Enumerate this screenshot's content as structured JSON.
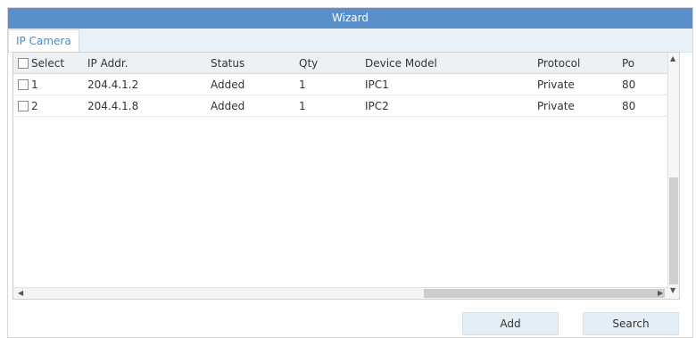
{
  "window": {
    "title": "Wizard"
  },
  "tabs": [
    {
      "label": "IP Camera",
      "active": true
    }
  ],
  "table": {
    "select_header": "Select",
    "columns": [
      "IP Addr.",
      "Status",
      "Qty",
      "Device Model",
      "Protocol",
      "Po"
    ],
    "rows": [
      {
        "select": "1",
        "ip": "204.4.1.2",
        "status": "Added",
        "qty": "1",
        "model": "IPC1",
        "protocol": "Private",
        "port": "80"
      },
      {
        "select": "2",
        "ip": "204.4.1.8",
        "status": "Added",
        "qty": "1",
        "model": "IPC2",
        "protocol": "Private",
        "port": "80"
      }
    ]
  },
  "buttons": {
    "add": "Add",
    "search": "Search"
  },
  "colors": {
    "title_bar": "#5b8fc9",
    "tab_text": "#3d8fd6",
    "button_bg": "#e3eef7"
  }
}
